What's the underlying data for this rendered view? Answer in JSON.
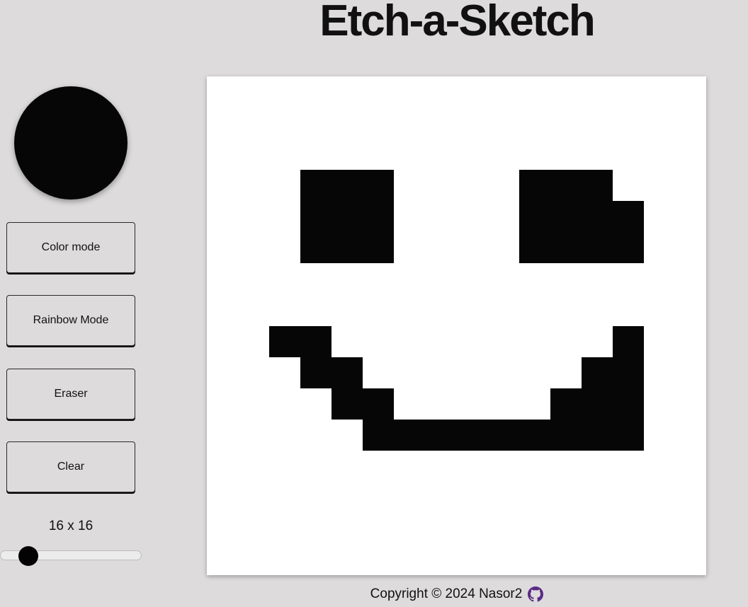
{
  "header": {
    "title": "Etch-a-Sketch"
  },
  "sidebar": {
    "current_color": "#060606",
    "buttons": {
      "color_mode": "Color mode",
      "rainbow_mode": "Rainbow Mode",
      "eraser": "Eraser",
      "clear": "Clear"
    },
    "grid_size_label": "16 x 16",
    "grid_size_slider": {
      "min": 1,
      "max": 100,
      "value": 16
    }
  },
  "board": {
    "grid_size": 16,
    "background_color": "#ffffff",
    "ink_color": "#060606",
    "painted_cells": [
      [
        3,
        3
      ],
      [
        3,
        4
      ],
      [
        3,
        5
      ],
      [
        3,
        10
      ],
      [
        3,
        11
      ],
      [
        3,
        12
      ],
      [
        4,
        3
      ],
      [
        4,
        4
      ],
      [
        4,
        5
      ],
      [
        4,
        10
      ],
      [
        4,
        11
      ],
      [
        4,
        12
      ],
      [
        4,
        13
      ],
      [
        5,
        3
      ],
      [
        5,
        4
      ],
      [
        5,
        5
      ],
      [
        5,
        10
      ],
      [
        5,
        11
      ],
      [
        5,
        12
      ],
      [
        5,
        13
      ],
      [
        8,
        2
      ],
      [
        8,
        3
      ],
      [
        8,
        13
      ],
      [
        9,
        3
      ],
      [
        9,
        4
      ],
      [
        9,
        12
      ],
      [
        9,
        13
      ],
      [
        10,
        4
      ],
      [
        10,
        5
      ],
      [
        10,
        11
      ],
      [
        10,
        12
      ],
      [
        10,
        13
      ],
      [
        11,
        5
      ],
      [
        11,
        6
      ],
      [
        11,
        7
      ],
      [
        11,
        8
      ],
      [
        11,
        9
      ],
      [
        11,
        10
      ],
      [
        11,
        11
      ],
      [
        11,
        12
      ],
      [
        11,
        13
      ]
    ]
  },
  "footer": {
    "copyright": "Copyright © 2024 Nasor2",
    "github_icon": "github-icon",
    "icon_color": "#5b2a86"
  }
}
